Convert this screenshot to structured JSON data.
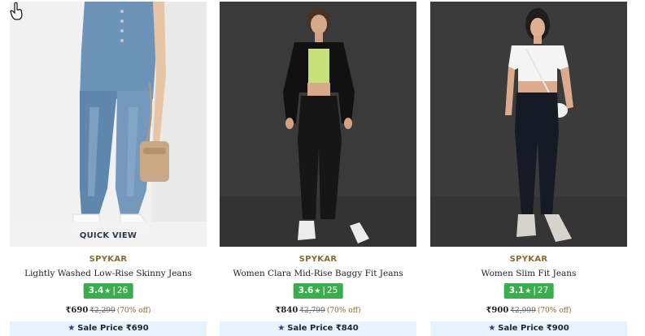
{
  "products": [
    {
      "brand": "SPYKAR",
      "title": "Lightly Washed Low-Rise Skinny Jeans",
      "rating": "3.4",
      "rating_star": "★",
      "rating_sep": "|",
      "reviews": "26",
      "price": "₹690",
      "mrp": "₹2,299",
      "discount": "(70% off)",
      "sale_label": "Sale Price ₹690",
      "quick_view": "QUICK VIEW"
    },
    {
      "brand": "SPYKAR",
      "title": "Women Clara Mid-Rise Baggy Fit Jeans",
      "rating": "3.6",
      "rating_star": "★",
      "rating_sep": "|",
      "reviews": "25",
      "price": "₹840",
      "mrp": "₹2,799",
      "discount": "(70% off)",
      "sale_label": "Sale Price ₹840"
    },
    {
      "brand": "SPYKAR",
      "title": "Women Slim Fit Jeans",
      "rating": "3.1",
      "rating_star": "★",
      "rating_sep": "|",
      "reviews": "27",
      "price": "₹900",
      "mrp": "₹2,999",
      "discount": "(70% off)",
      "sale_label": "Sale Price ₹900"
    }
  ],
  "icons": {
    "sale_star": "★",
    "cursor": "hand-pointer-cursor"
  },
  "colors": {
    "brand_text": "#8c6a32",
    "rating_bg": "#3aae4d",
    "sale_bg": "#e6f3fc",
    "sale_star": "#2d3a8c"
  }
}
